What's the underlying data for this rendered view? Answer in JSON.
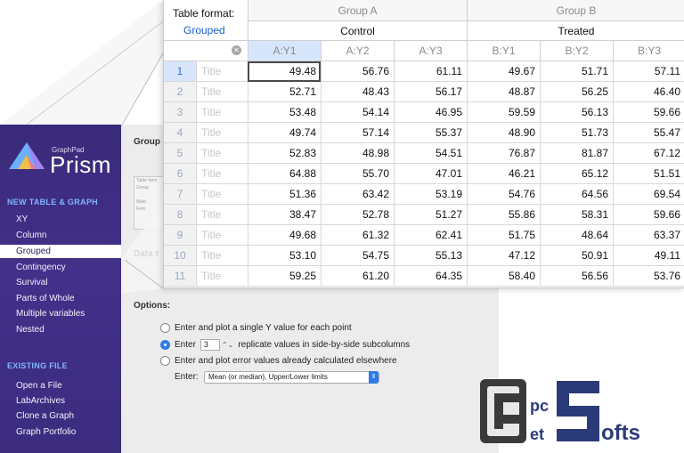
{
  "sidebar": {
    "logo_small": "GraphPad",
    "logo_big": "Prism",
    "new_heading": "NEW TABLE & GRAPH",
    "new_items": [
      "XY",
      "Column",
      "Grouped",
      "Contingency",
      "Survival",
      "Parts of Whole",
      "Multiple variables",
      "Nested"
    ],
    "selected_item": "Grouped",
    "existing_heading": "EXISTING FILE",
    "existing_items": [
      "Open a File",
      "LabArchives",
      "Clone a Graph",
      "Graph Portfolio"
    ]
  },
  "main": {
    "group_label": "Group",
    "data_label": "Data t",
    "mini_table": {
      "line1": "Table form",
      "line2": "Group",
      "line3": "Male",
      "line4": "Fem"
    },
    "options_label": "Options:",
    "options": [
      "Enter and plot a single Y value for each point",
      "replicate values in side-by-side subcolumns",
      "Enter and plot error values already calculated elsewhere"
    ],
    "enter_word": "Enter",
    "replicate_count": "3",
    "stepper_arrows": "⌃⌄",
    "enter_label": "Enter:",
    "enter_select": "Mean (or median), Upper/Lower limits",
    "select_arrow": "⇕"
  },
  "table": {
    "format_label": "Table format:",
    "format_value": "Grouped",
    "close_glyph": "✕",
    "groups": [
      {
        "name": "Group A",
        "title": "Control",
        "cols": [
          "A:Y1",
          "A:Y2",
          "A:Y3"
        ]
      },
      {
        "name": "Group B",
        "title": "Treated",
        "cols": [
          "B:Y1",
          "B:Y2",
          "B:Y3"
        ]
      }
    ],
    "row_title_placeholder": "Title",
    "rows": [
      {
        "n": "1",
        "v": [
          "49.48",
          "56.76",
          "61.11",
          "49.67",
          "51.71",
          "57.11"
        ]
      },
      {
        "n": "2",
        "v": [
          "52.71",
          "48.43",
          "56.17",
          "48.87",
          "56.25",
          "46.40"
        ]
      },
      {
        "n": "3",
        "v": [
          "53.48",
          "54.14",
          "46.95",
          "59.59",
          "56.13",
          "59.66"
        ]
      },
      {
        "n": "4",
        "v": [
          "49.74",
          "57.14",
          "55.37",
          "48.90",
          "51.73",
          "55.47"
        ]
      },
      {
        "n": "5",
        "v": [
          "52.83",
          "48.98",
          "54.51",
          "76.87",
          "81.87",
          "67.12"
        ]
      },
      {
        "n": "6",
        "v": [
          "64.88",
          "55.70",
          "47.01",
          "46.21",
          "65.12",
          "51.51"
        ]
      },
      {
        "n": "7",
        "v": [
          "51.36",
          "63.42",
          "53.19",
          "54.76",
          "64.56",
          "69.54"
        ]
      },
      {
        "n": "8",
        "v": [
          "38.47",
          "52.78",
          "51.27",
          "55.86",
          "58.31",
          "59.66"
        ]
      },
      {
        "n": "9",
        "v": [
          "49.68",
          "61.32",
          "62.41",
          "51.75",
          "48.64",
          "63.37"
        ]
      },
      {
        "n": "10",
        "v": [
          "53.10",
          "54.75",
          "55.13",
          "47.12",
          "50.91",
          "49.11"
        ]
      },
      {
        "n": "11",
        "v": [
          "59.25",
          "61.20",
          "64.35",
          "58.40",
          "56.56",
          "53.76"
        ]
      }
    ]
  },
  "watermark": {
    "letters": [
      "G",
      "pc",
      "et",
      "S",
      "ofts"
    ]
  },
  "colors": {
    "sidebar": "#3a2a7a",
    "accent": "#2f7ce8",
    "link": "#1a5fd0",
    "selected_col": "#d7e6fb"
  }
}
